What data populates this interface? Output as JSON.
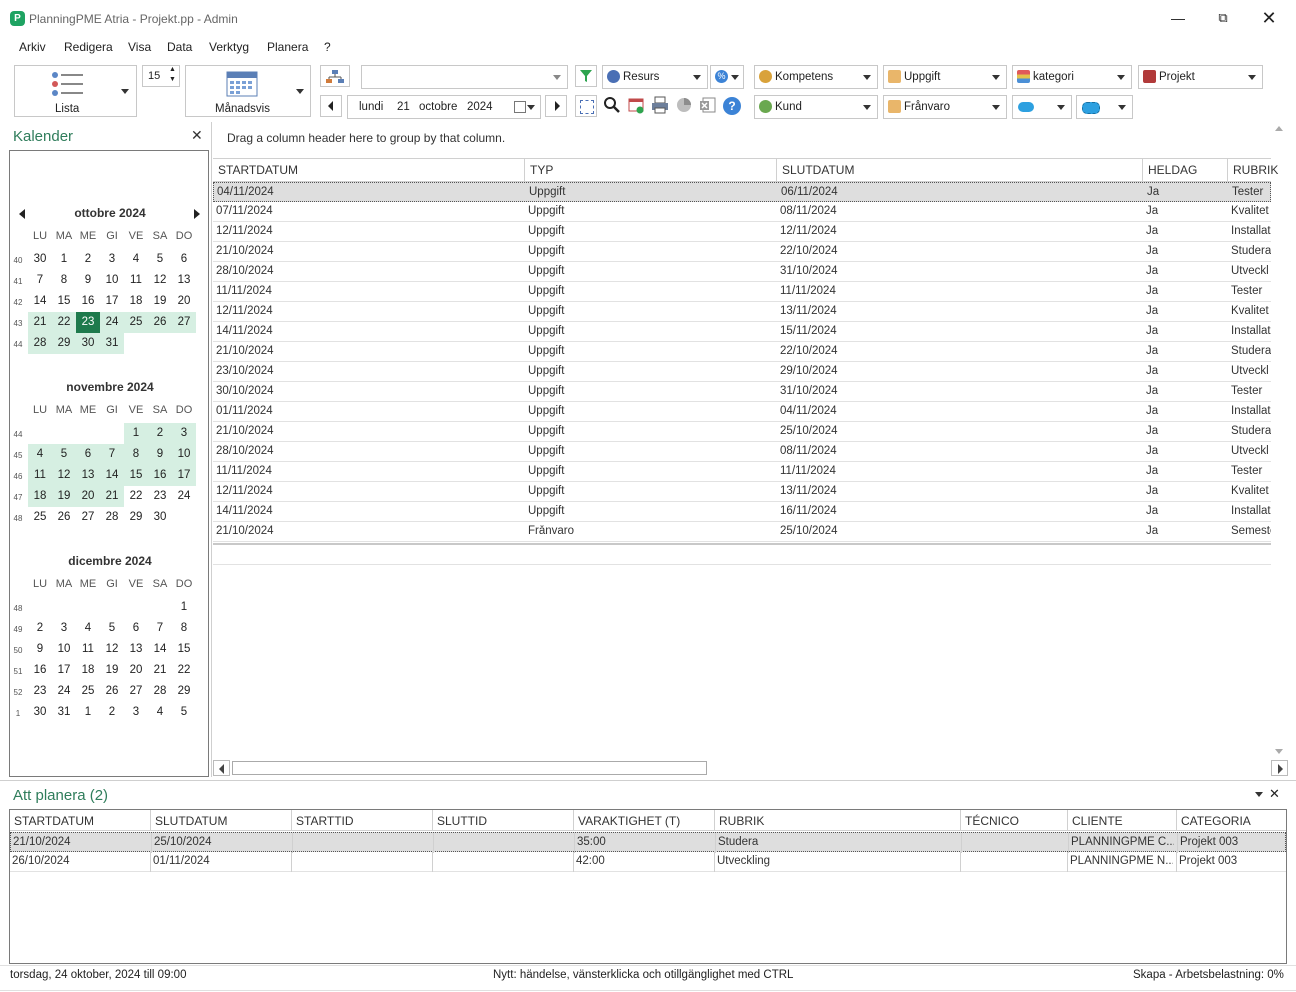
{
  "window": {
    "title": "PlanningPME Atria - Projekt.pp - Admin",
    "app_icon": "P"
  },
  "menu": [
    "Arkiv",
    "Redigera",
    "Visa",
    "Data",
    "Verktyg",
    "Planera",
    "?"
  ],
  "toolbar": {
    "view_list_label": "Lista",
    "spinner_value": "15",
    "view_month_label": "Månadsvis",
    "date": {
      "weekday": "lundi",
      "day": "21",
      "month": "octobre",
      "year": "2024"
    },
    "combos": {
      "resurs": "Resurs",
      "kompetens": "Kompetens",
      "uppgift": "Uppgift",
      "kategori": "kategori",
      "projekt": "Projekt",
      "kund": "Kund",
      "franvaro": "Frånvaro"
    }
  },
  "calendar_panel": {
    "title": "Kalender",
    "weekdays": [
      "LU",
      "MA",
      "ME",
      "GI",
      "VE",
      "SA",
      "DO"
    ],
    "months": [
      {
        "title": "ottobre 2024",
        "weeks": [
          {
            "wk": "40",
            "days": [
              "30",
              "1",
              "2",
              "3",
              "4",
              "5",
              "6"
            ]
          },
          {
            "wk": "41",
            "days": [
              "7",
              "8",
              "9",
              "10",
              "11",
              "12",
              "13"
            ]
          },
          {
            "wk": "42",
            "days": [
              "14",
              "15",
              "16",
              "17",
              "18",
              "19",
              "20"
            ]
          },
          {
            "wk": "43",
            "days": [
              "21",
              "22",
              "23",
              "24",
              "25",
              "26",
              "27"
            ]
          },
          {
            "wk": "44",
            "days": [
              "28",
              "29",
              "30",
              "31",
              "",
              "",
              ""
            ]
          }
        ]
      },
      {
        "title": "novembre 2024",
        "weeks": [
          {
            "wk": "44",
            "days": [
              "",
              "",
              "",
              "",
              "1",
              "2",
              "3"
            ]
          },
          {
            "wk": "45",
            "days": [
              "4",
              "5",
              "6",
              "7",
              "8",
              "9",
              "10"
            ]
          },
          {
            "wk": "46",
            "days": [
              "11",
              "12",
              "13",
              "14",
              "15",
              "16",
              "17"
            ]
          },
          {
            "wk": "47",
            "days": [
              "18",
              "19",
              "20",
              "21",
              "22",
              "23",
              "24"
            ]
          },
          {
            "wk": "48",
            "days": [
              "25",
              "26",
              "27",
              "28",
              "29",
              "30",
              ""
            ]
          }
        ]
      },
      {
        "title": "dicembre 2024",
        "weeks": [
          {
            "wk": "48",
            "days": [
              "",
              "",
              "",
              "",
              "",
              "",
              "1"
            ]
          },
          {
            "wk": "49",
            "days": [
              "2",
              "3",
              "4",
              "5",
              "6",
              "7",
              "8"
            ]
          },
          {
            "wk": "50",
            "days": [
              "9",
              "10",
              "11",
              "12",
              "13",
              "14",
              "15"
            ]
          },
          {
            "wk": "51",
            "days": [
              "16",
              "17",
              "18",
              "19",
              "20",
              "21",
              "22"
            ]
          },
          {
            "wk": "52",
            "days": [
              "23",
              "24",
              "25",
              "26",
              "27",
              "28",
              "29"
            ]
          },
          {
            "wk": "1",
            "days": [
              "30",
              "31",
              "1",
              "2",
              "3",
              "4",
              "5"
            ]
          }
        ]
      }
    ]
  },
  "main_grid": {
    "group_hint": "Drag a column header here to group by that column.",
    "columns": [
      "STARTDATUM",
      "TYP",
      "SLUTDATUM",
      "HELDAG",
      "RUBRIK"
    ],
    "rows": [
      [
        "04/11/2024",
        "Uppgift",
        "06/11/2024",
        "Ja",
        "Tester"
      ],
      [
        "07/11/2024",
        "Uppgift",
        "08/11/2024",
        "Ja",
        "Kvalitet"
      ],
      [
        "12/11/2024",
        "Uppgift",
        "12/11/2024",
        "Ja",
        "Installat"
      ],
      [
        "21/10/2024",
        "Uppgift",
        "22/10/2024",
        "Ja",
        "Studera"
      ],
      [
        "28/10/2024",
        "Uppgift",
        "31/10/2024",
        "Ja",
        "Utveckl"
      ],
      [
        "11/11/2024",
        "Uppgift",
        "11/11/2024",
        "Ja",
        "Tester"
      ],
      [
        "12/11/2024",
        "Uppgift",
        "13/11/2024",
        "Ja",
        "Kvalitet"
      ],
      [
        "14/11/2024",
        "Uppgift",
        "15/11/2024",
        "Ja",
        "Installat"
      ],
      [
        "21/10/2024",
        "Uppgift",
        "22/10/2024",
        "Ja",
        "Studera"
      ],
      [
        "23/10/2024",
        "Uppgift",
        "29/10/2024",
        "Ja",
        "Utveckl"
      ],
      [
        "30/10/2024",
        "Uppgift",
        "31/10/2024",
        "Ja",
        "Tester"
      ],
      [
        "01/11/2024",
        "Uppgift",
        "04/11/2024",
        "Ja",
        "Installat"
      ],
      [
        "21/10/2024",
        "Uppgift",
        "25/10/2024",
        "Ja",
        "Studera"
      ],
      [
        "28/10/2024",
        "Uppgift",
        "08/11/2024",
        "Ja",
        "Utveckl"
      ],
      [
        "11/11/2024",
        "Uppgift",
        "11/11/2024",
        "Ja",
        "Tester"
      ],
      [
        "12/11/2024",
        "Uppgift",
        "13/11/2024",
        "Ja",
        "Kvalitet"
      ],
      [
        "14/11/2024",
        "Uppgift",
        "16/11/2024",
        "Ja",
        "Installat"
      ],
      [
        "21/10/2024",
        "Frånvaro",
        "25/10/2024",
        "Ja",
        "Semeste"
      ]
    ]
  },
  "att_planera": {
    "title": "Att planera (2)",
    "columns": [
      "STARTDATUM",
      "SLUTDATUM",
      "STARTTID",
      "SLUTTID",
      "VARAKTIGHET (T)",
      "RUBRIK",
      "TÉCNICO",
      "CLIENTE",
      "CATEGORIA"
    ],
    "rows": [
      [
        "21/10/2024",
        "25/10/2024",
        "",
        "",
        "35:00",
        "Studera",
        "",
        "PLANNINGPME C...",
        "Projekt 003"
      ],
      [
        "26/10/2024",
        "01/11/2024",
        "",
        "",
        "42:00",
        "Utveckling",
        "",
        "PLANNINGPME N...",
        "Projekt 003"
      ]
    ]
  },
  "status": {
    "left": "torsdag, 24 oktober, 2024 till 09:00",
    "middle": "Nytt: händelse, vänsterklicka och otillgänglighet med CTRL",
    "right": "Skapa - Arbetsbelastning: 0%"
  },
  "colors": {
    "accent": "#2f7d5b",
    "today": "#1e7a4c",
    "highlight": "#d6efe2"
  }
}
